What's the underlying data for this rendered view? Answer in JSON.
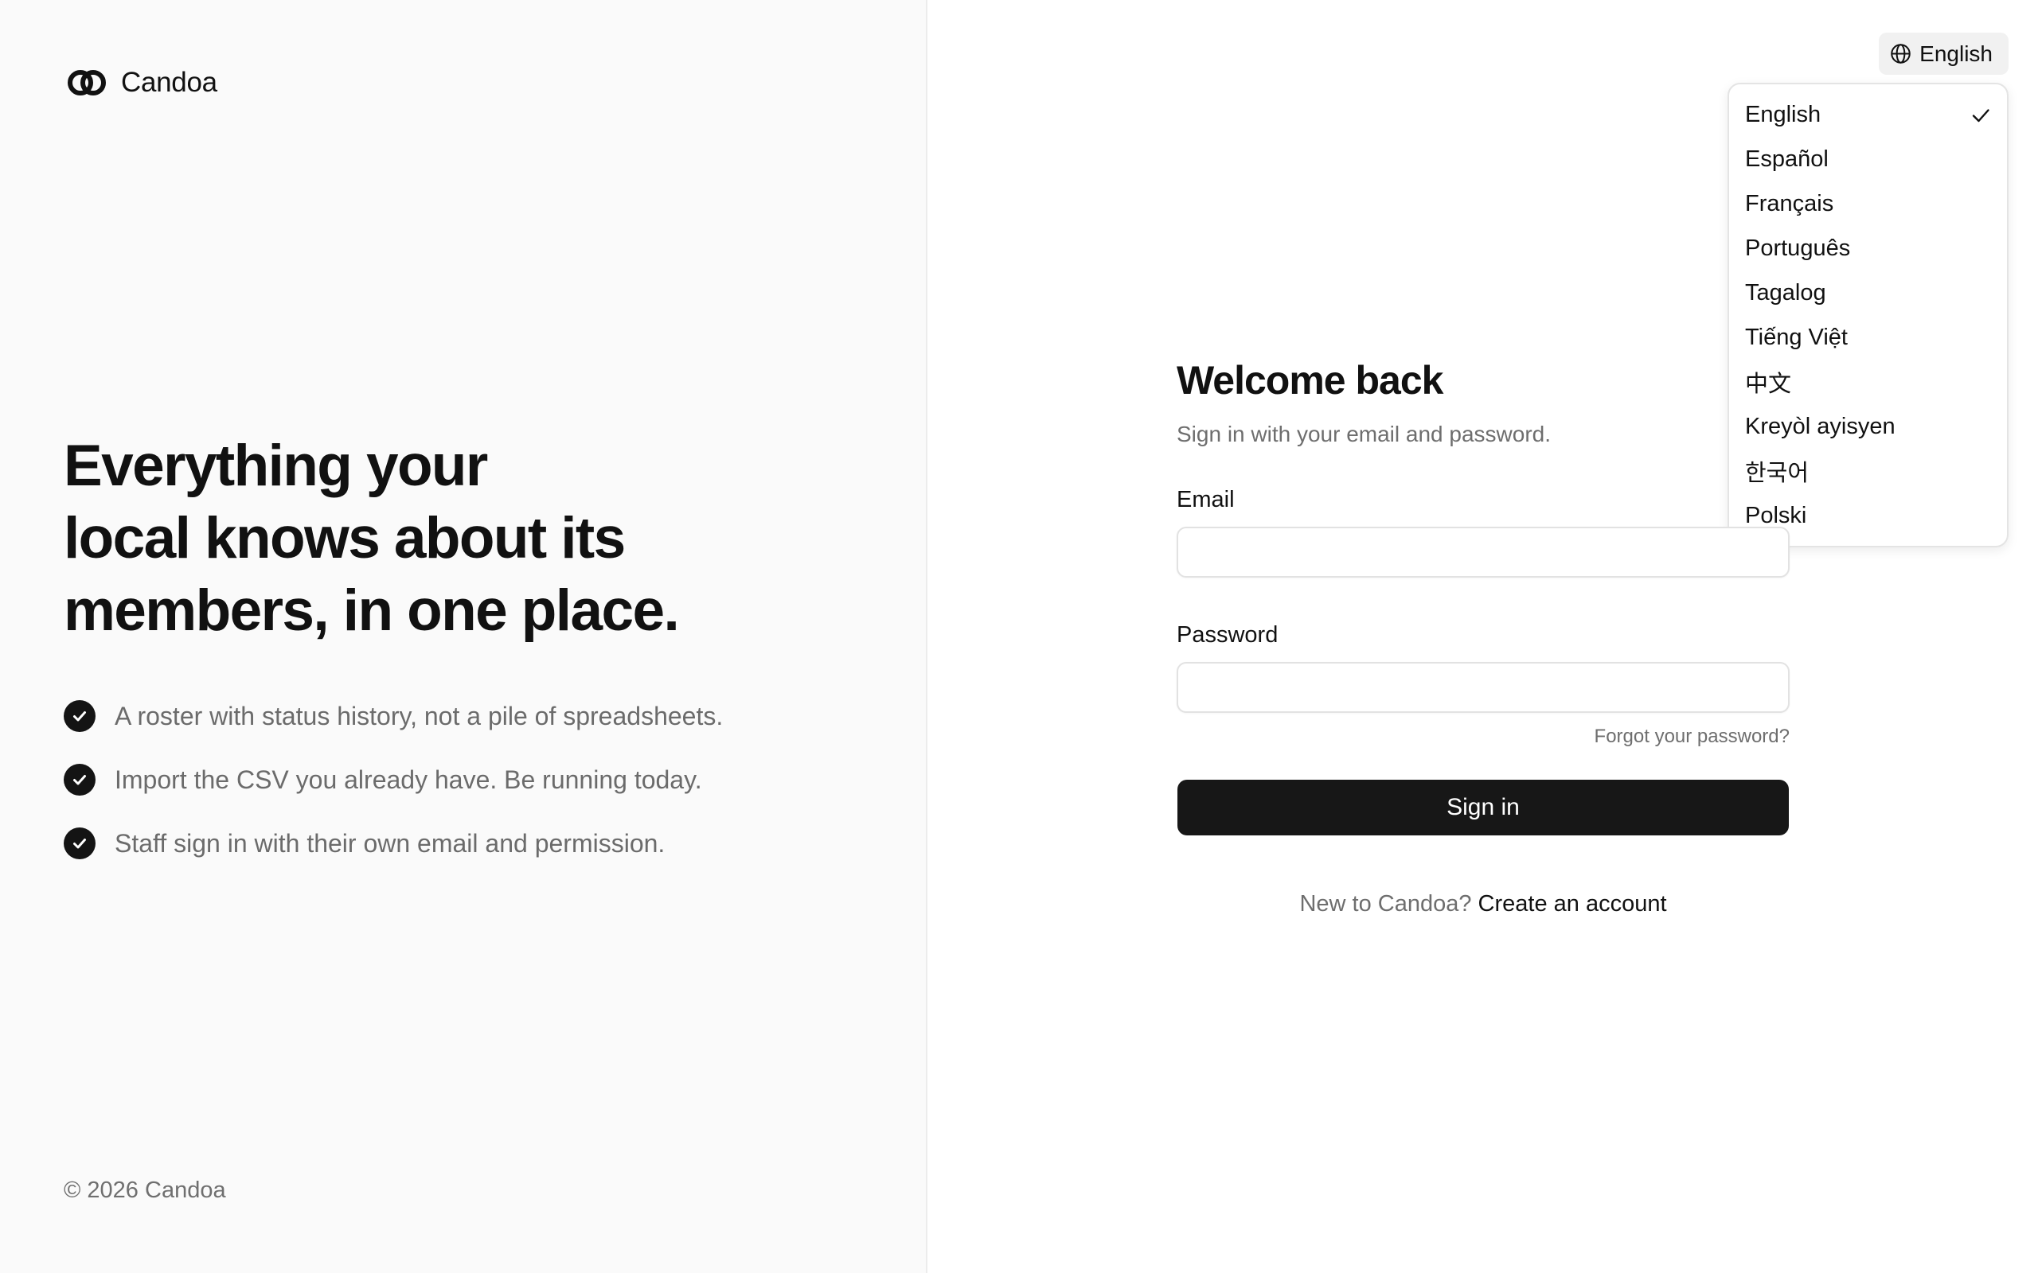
{
  "brand": {
    "name": "Candoa"
  },
  "hero": {
    "headline_lines": [
      "Everything your",
      "local knows about its",
      "members, in one place."
    ],
    "features": [
      "A roster with status history, not a pile of spreadsheets.",
      "Import the CSV you already have. Be running today.",
      "Staff sign in with their own email and permission."
    ]
  },
  "footer": {
    "copyright": "© 2026 Candoa"
  },
  "language": {
    "current": "English",
    "options": [
      {
        "label": "English",
        "selected": true
      },
      {
        "label": "Español",
        "selected": false
      },
      {
        "label": "Français",
        "selected": false
      },
      {
        "label": "Português",
        "selected": false
      },
      {
        "label": "Tagalog",
        "selected": false
      },
      {
        "label": "Tiếng Việt",
        "selected": false
      },
      {
        "label": "中文",
        "selected": false
      },
      {
        "label": "Kreyòl ayisyen",
        "selected": false
      },
      {
        "label": "한국어",
        "selected": false
      },
      {
        "label": "Polski",
        "selected": false
      }
    ]
  },
  "form": {
    "title": "Welcome back",
    "subtitle": "Sign in with your email and password.",
    "email_label": "Email",
    "email_value": "",
    "password_label": "Password",
    "password_value": "",
    "forgot_link": "Forgot your password?",
    "submit_label": "Sign in",
    "signup_prompt": "New to Candoa?",
    "signup_link": "Create an account"
  },
  "icons": {
    "logo": "interlocking-rings-logo",
    "feature_check": "check-circle-icon",
    "language": "globe-icon",
    "selected": "check-icon"
  },
  "colors": {
    "primary": "#171717",
    "left_panel_bg": "#fafafa",
    "muted_text": "#6e6e6e"
  }
}
